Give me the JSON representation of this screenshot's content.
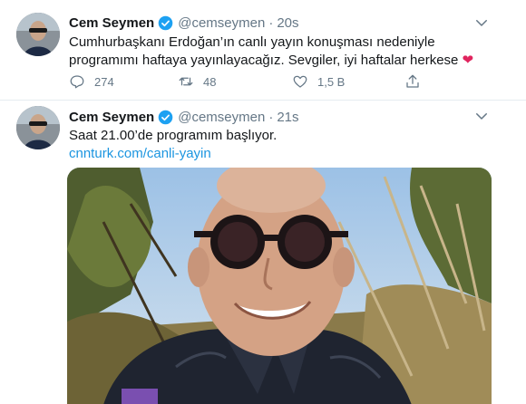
{
  "tweets": [
    {
      "author_name": "Cem Seymen",
      "handle": "@cemseymen",
      "separator": "·",
      "time": "20s",
      "text": "Cumhurbaşkanı Erdoğan’ın canlı yayın konuşması nedeniyle programımı haftaya yayınlayacağız. Sevgiler, iyi haftalar herkese",
      "emoji": "❤",
      "replies": "274",
      "retweets": "48",
      "likes": "1,5 B"
    },
    {
      "author_name": "Cem Seymen",
      "handle": "@cemseymen",
      "separator": "·",
      "time": "21s",
      "text": "Saat 21.00’de programım başlıyor.",
      "link": "cnnturk.com/canli-yayin"
    }
  ],
  "colors": {
    "link": "#1b95e0",
    "verified": "#1da1f2",
    "muted": "#657786",
    "heart": "#e0245e"
  },
  "icons": [
    "verified-badge-icon",
    "chevron-down-icon",
    "reply-icon",
    "retweet-icon",
    "like-icon",
    "share-icon"
  ]
}
